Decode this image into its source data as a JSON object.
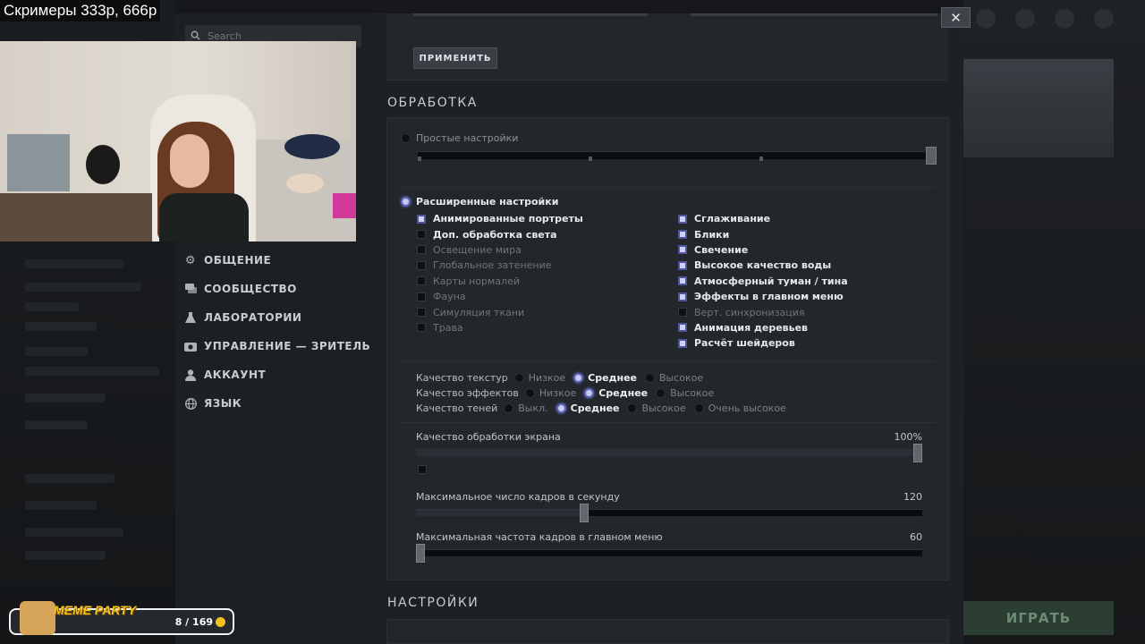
{
  "stream_overlay": {
    "title": "Скримеры 333р, 666р",
    "meme_party": {
      "label": "MEME PARTY",
      "count": "8 / 169"
    }
  },
  "search": {
    "placeholder": "Search"
  },
  "nav": {
    "items": [
      {
        "label": "ОБЩЕНИЕ",
        "icon": "gear-icon"
      },
      {
        "label": "СООБЩЕСТВО",
        "icon": "chat-icon"
      },
      {
        "label": "ЛАБОРАТОРИИ",
        "icon": "flask-icon"
      },
      {
        "label": "УПРАВЛЕНИЕ — ЗРИТЕЛЬ",
        "icon": "camera-icon"
      },
      {
        "label": "АККАУНТ",
        "icon": "user-icon"
      },
      {
        "label": "ЯЗЫК",
        "icon": "globe-icon"
      }
    ]
  },
  "apply_button": "ПРИМЕНИТЬ",
  "processing": {
    "title": "ОБРАБОТКА",
    "simple_label": "Простые настройки",
    "advanced_label": "Расширенные настройки",
    "left_checks": [
      {
        "label": "Анимированные портреты",
        "checked": true
      },
      {
        "label": "Доп. обработка света",
        "checked": false
      },
      {
        "label": "Освещение мира",
        "checked": false,
        "disabled": true
      },
      {
        "label": "Глобальное затенение",
        "checked": false,
        "disabled": true
      },
      {
        "label": "Карты нормалей",
        "checked": false,
        "disabled": true
      },
      {
        "label": "Фауна",
        "checked": false,
        "disabled": true
      },
      {
        "label": "Симуляция ткани",
        "checked": false,
        "disabled": true
      },
      {
        "label": "Трава",
        "checked": false,
        "disabled": true
      }
    ],
    "right_checks": [
      {
        "label": "Сглаживание",
        "checked": true
      },
      {
        "label": "Блики",
        "checked": true
      },
      {
        "label": "Свечение",
        "checked": true
      },
      {
        "label": "Высокое качество воды",
        "checked": true
      },
      {
        "label": "Атмосферный туман / тина",
        "checked": true
      },
      {
        "label": "Эффекты в главном меню",
        "checked": true
      },
      {
        "label": "Верт. синхронизация",
        "checked": false,
        "disabled": true
      },
      {
        "label": "Анимация деревьев",
        "checked": true
      },
      {
        "label": "Расчёт шейдеров",
        "checked": true
      }
    ],
    "quality": [
      {
        "label": "Качество текстур",
        "options": [
          "Низкое",
          "Среднее",
          "Высокое"
        ],
        "selected": "Среднее"
      },
      {
        "label": "Качество эффектов",
        "options": [
          "Низкое",
          "Среднее",
          "Высокое"
        ],
        "selected": "Среднее"
      },
      {
        "label": "Качество теней",
        "options": [
          "Выкл.",
          "Среднее",
          "Высокое",
          "Очень высокое"
        ],
        "selected": "Среднее"
      }
    ],
    "screen_quality": {
      "label": "Качество обработки экрана",
      "value": "100%",
      "level": 1.0
    },
    "max_fps": {
      "label": "Максимальное число кадров в секунду",
      "value": "120",
      "level": 0.33
    },
    "menu_fps": {
      "label": "Максимальная частота кадров в главном меню",
      "value": "60",
      "level": 0.0
    }
  },
  "settings_title": "НАСТРОЙКИ",
  "play_button": "ИГРАТЬ",
  "close_label": "✕"
}
